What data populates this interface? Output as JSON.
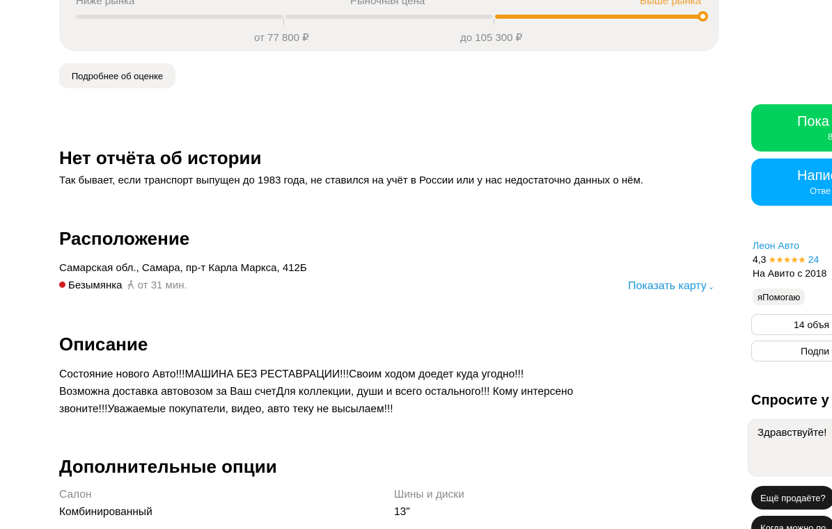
{
  "price_estimate": {
    "below_label": "Ниже рынка",
    "market_label": "Рыночная цена",
    "above_label": "Выше рынка",
    "from_label": "от 77 800 ₽",
    "to_label": "до 105 300 ₽",
    "details_button": "Подробнее об оценке",
    "accent_color": "#f09a14"
  },
  "history": {
    "title": "Нет отчёта об истории",
    "text": "Так бывает, если транспорт выпущен до 1983 года, не ставился на учёт в России или у нас недостаточно данных о нём."
  },
  "location": {
    "title": "Расположение",
    "address": "Самарская обл., Самара, пр-т Карла Маркса, 412Б",
    "metro": "Безымянка",
    "walk_time": "от 31 мин.",
    "show_map": "Показать карту",
    "metro_color": "#d21c1c"
  },
  "description": {
    "title": "Описание",
    "text": "Состояние нового Авто!!!МАШИНА БЕЗ РЕСТАВРАЦИИ!!!Своим ходом доедет куда угодно!!! Возможна доставка автовозом за Ваш счетДля коллекции, души и всего остального!!! Кому интерсено звоните!!!Уважаемые покупатели, видео, авто теку не высылаем!!!"
  },
  "options": {
    "title": "Дополнительные опции",
    "items": [
      {
        "label": "Салон",
        "value": "Комбинированный"
      },
      {
        "label": "Шины и диски",
        "value": "13\""
      }
    ]
  },
  "sidebar": {
    "show_phone": {
      "title": "Пока",
      "subtitle": "8",
      "color": "#02d15c"
    },
    "write": {
      "title": "Напис",
      "subtitle": "Отве",
      "color": "#00aaff"
    },
    "seller": {
      "name": "Леон Авто",
      "rating": "4,3",
      "rating_count": "24",
      "since": "На Авито с 2018",
      "badge": "яПомогаю"
    },
    "ads_button": "14 объя",
    "subscribe_button": "Подпи",
    "ask_title": "Спросите у",
    "message_text": "Здравствуйте!",
    "chips": [
      "Ещё продаёте?",
      "Когда можно по"
    ]
  }
}
